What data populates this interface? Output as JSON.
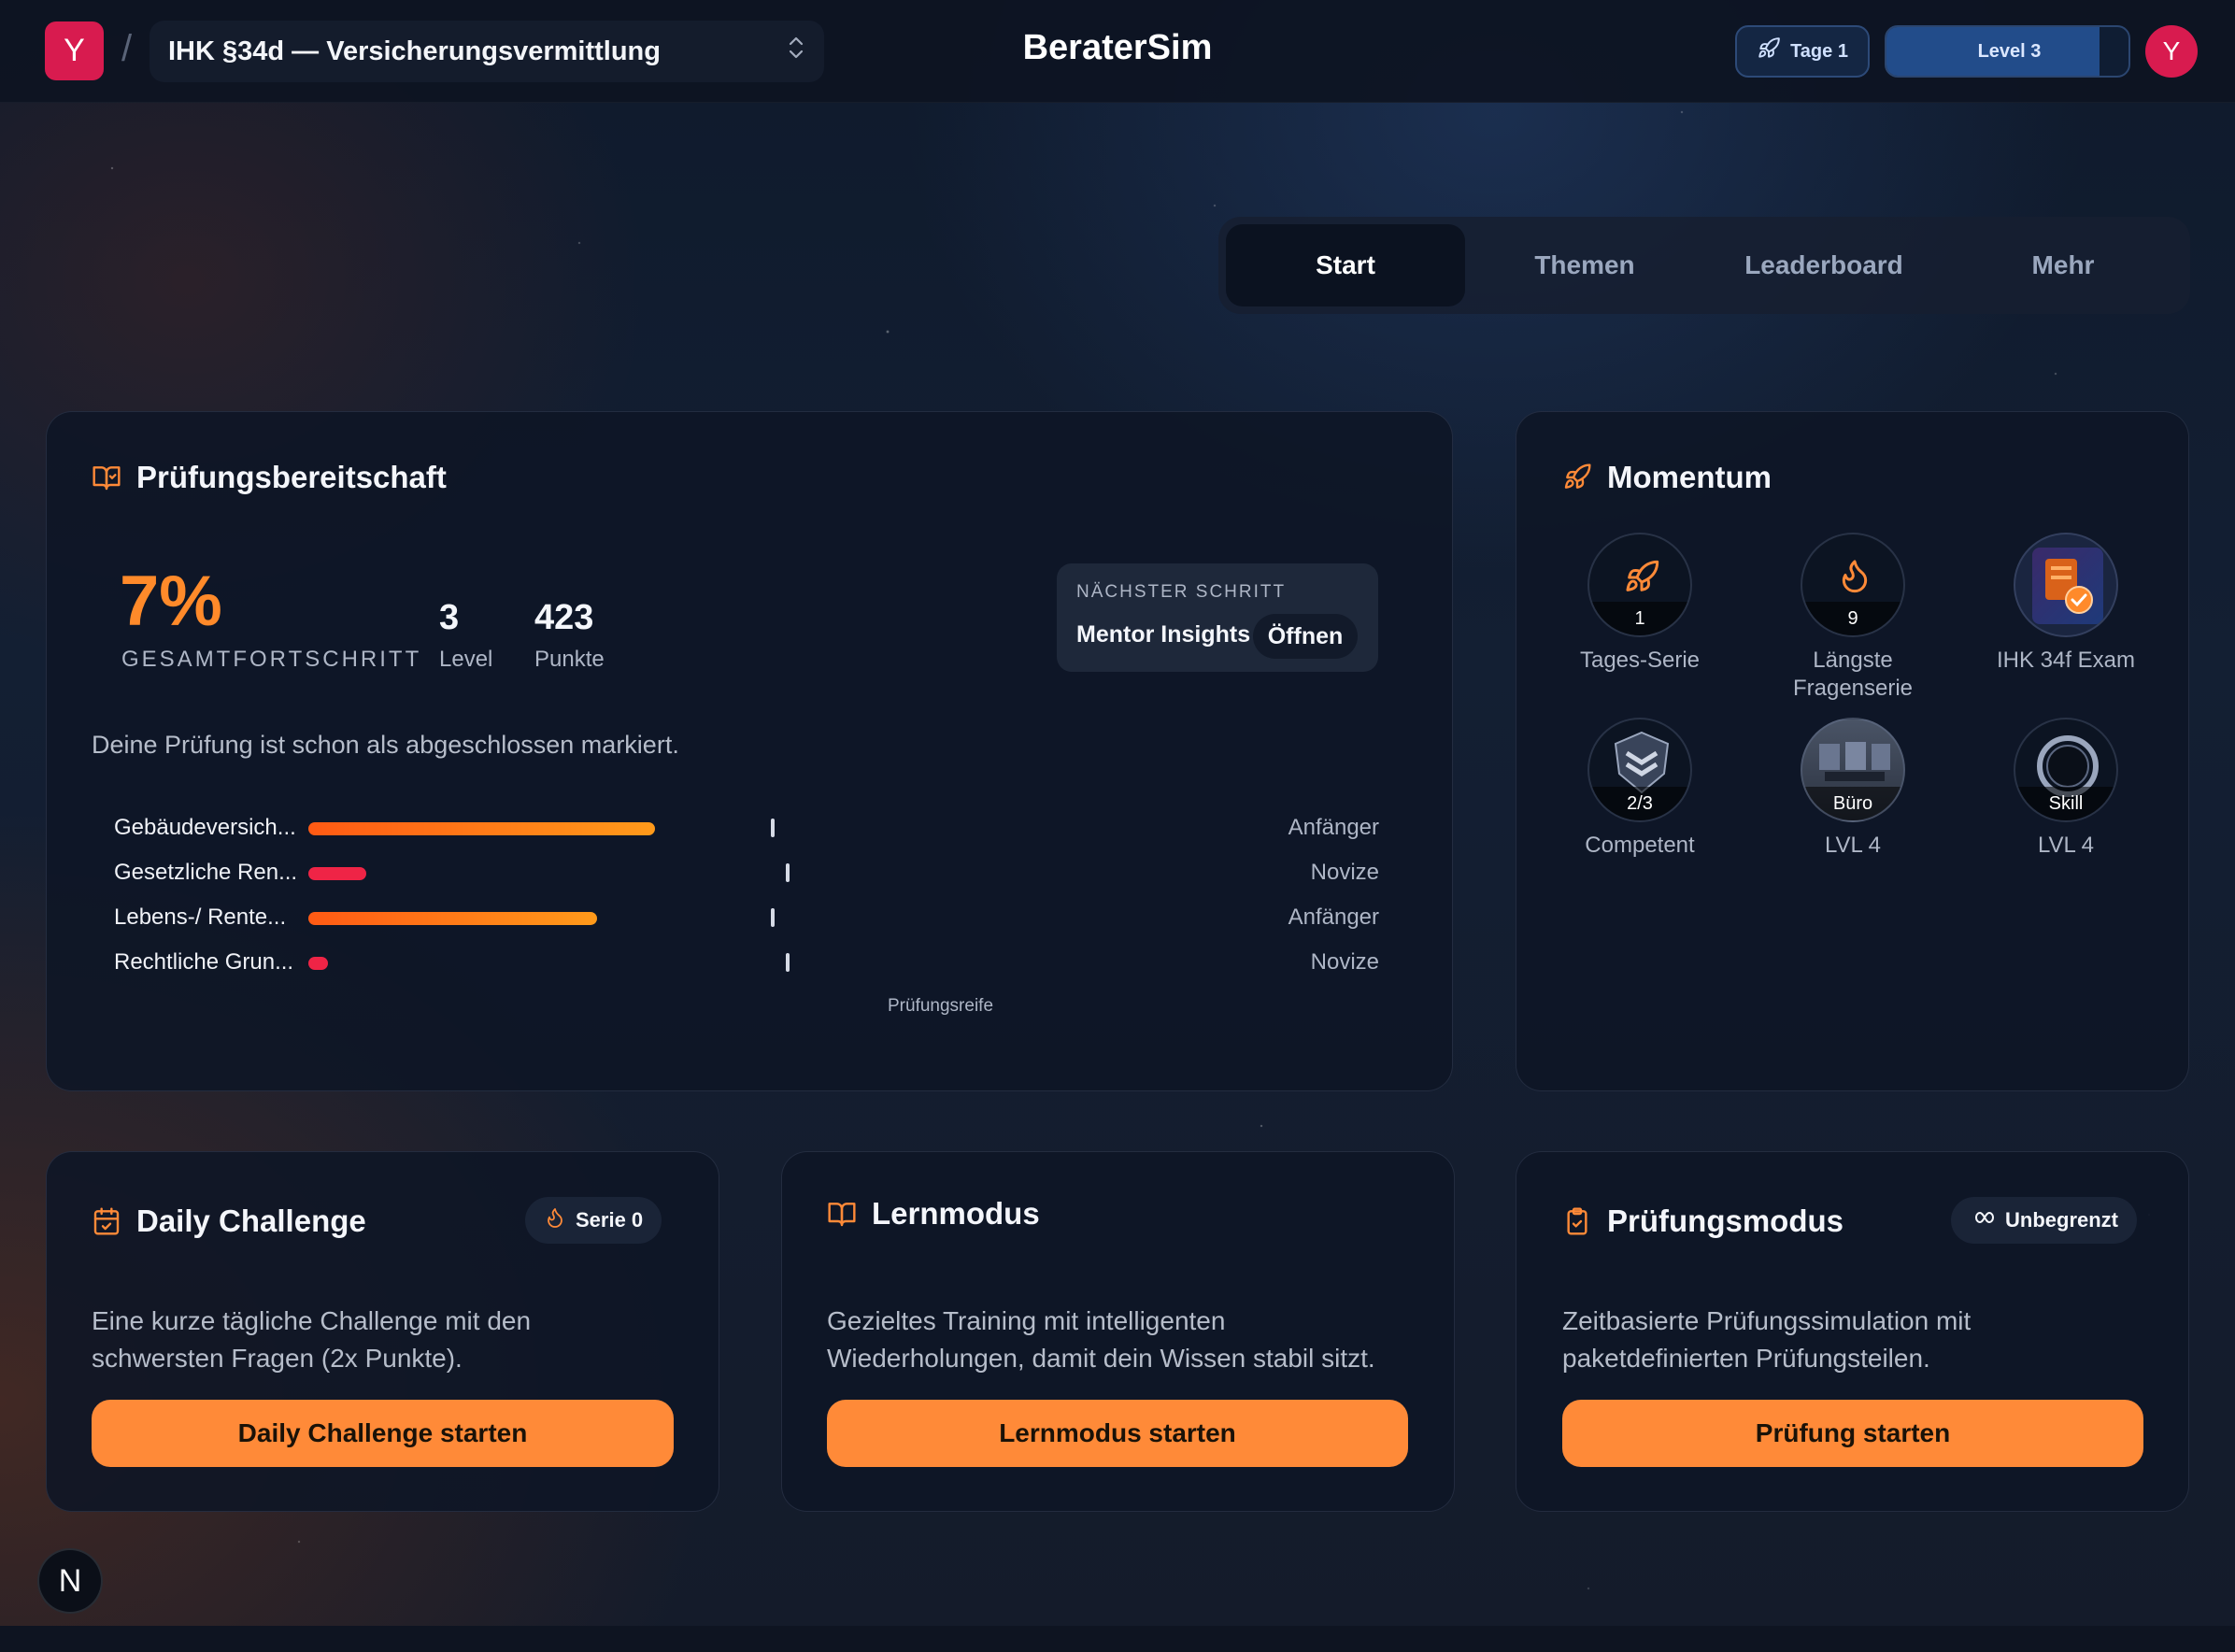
{
  "header": {
    "org_initial": "Y",
    "course_title": "IHK §34d — Versicherungsvermittlung",
    "app_title": "BeraterSim",
    "streak_label": "Tage 1",
    "level_label": "Level 3",
    "level_progress": 0.88,
    "user_initial": "Y"
  },
  "tabs": [
    {
      "label": "Start",
      "active": true
    },
    {
      "label": "Themen",
      "active": false
    },
    {
      "label": "Leaderboard",
      "active": false
    },
    {
      "label": "Mehr",
      "active": false
    }
  ],
  "readiness": {
    "title": "Prüfungsbereitschaft",
    "percent": "7%",
    "percent_label": "GESAMTFORTSCHRITT",
    "level_value": "3",
    "level_label": "Level",
    "points_value": "423",
    "points_label": "Punkte",
    "next_step_heading": "NÄCHSTER SCHRITT",
    "next_step_name": "Mentor Insights",
    "next_step_action": "Öffnen",
    "note": "Deine Prüfung ist schon als abgeschlossen markiert.",
    "marker_label": "Prüfungsreife",
    "topics": [
      {
        "name": "Gebäudeversich...",
        "progress": 0.36,
        "marker": 0.605,
        "level": "Anfänger",
        "color": "orange"
      },
      {
        "name": "Gesetzliche Ren...",
        "progress": 0.06,
        "marker": 0.62,
        "level": "Novize",
        "color": "red"
      },
      {
        "name": "Lebens-/ Rente...",
        "progress": 0.3,
        "marker": 0.605,
        "level": "Anfänger",
        "color": "orange"
      },
      {
        "name": "Rechtliche Grun...",
        "progress": 0.02,
        "marker": 0.62,
        "level": "Novize",
        "color": "red"
      }
    ]
  },
  "momentum": {
    "title": "Momentum",
    "badges": [
      {
        "value": "1",
        "caption": "Tages-Serie",
        "icon": "rocket-icon"
      },
      {
        "value": "9",
        "caption": "Längste Fragenserie",
        "icon": "flame-icon"
      },
      {
        "value": "",
        "caption": "IHK 34f Exam",
        "icon": "exam-badge-icon"
      },
      {
        "value": "2/3",
        "caption": "Competent",
        "icon": "shield-chevron-icon"
      },
      {
        "value": "Büro",
        "caption": "LVL 4",
        "icon": "office-icon"
      },
      {
        "value": "Skill",
        "caption": "LVL 4",
        "icon": "portal-ring-icon"
      }
    ]
  },
  "modes": {
    "daily": {
      "title": "Daily Challenge",
      "pill": "Serie 0",
      "description": "Eine kurze tägliche Challenge mit den schwersten Fragen (2x Punkte).",
      "button": "Daily Challenge starten"
    },
    "learn": {
      "title": "Lernmodus",
      "description": "Gezieltes Training mit intelligenten Wiederholungen, damit dein Wissen stabil sitzt.",
      "button": "Lernmodus starten"
    },
    "exam": {
      "title": "Prüfungsmodus",
      "pill": "Unbegrenzt",
      "description": "Zeitbasierte Prüfungssimulation mit paketdefinierten Prüfungsteilen.",
      "button": "Prüfung starten"
    }
  },
  "footer": {
    "framework_initial": "N"
  },
  "colors": {
    "accent": "#ff8a38",
    "orange_bar": "#ff7a1a",
    "red_bar": "#ef2446",
    "brand": "#d81b4f"
  }
}
